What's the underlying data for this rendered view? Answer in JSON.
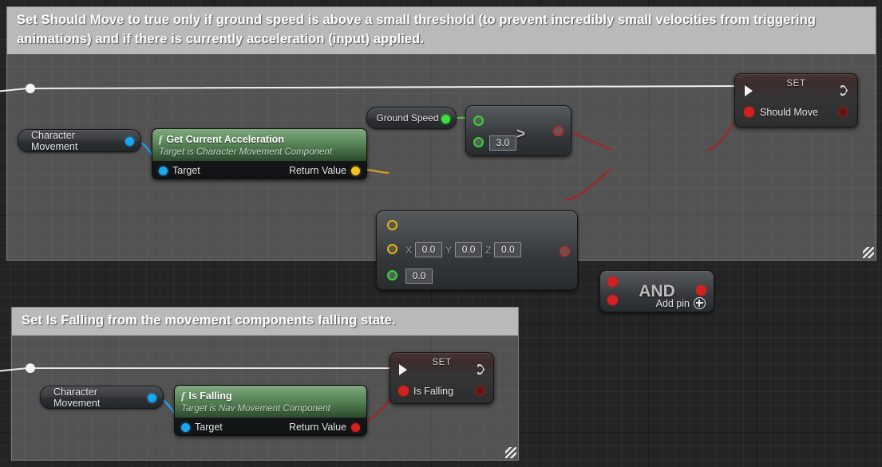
{
  "app": {
    "name": "Unreal Engine Blueprint Graph",
    "canvas_bg": "#242424"
  },
  "comments": [
    {
      "id": "comment-should-move",
      "text": "Set Should Move to true only if ground speed is above a small threshold (to prevent incredibly small velocities from triggering animations) and if there is currently acceleration (input) applied.",
      "bar_color": "#b9b9b9",
      "fill_color": "#969696"
    },
    {
      "id": "comment-is-falling",
      "text": "Set Is Falling from the movement components falling state.",
      "bar_color": "#b9b9b9",
      "fill_color": "#969696"
    }
  ],
  "nodes": {
    "character_movement_1": {
      "label": "Character Movement",
      "pin_color": "#19a6f0"
    },
    "character_movement_2": {
      "label": "Character Movement",
      "pin_color": "#19a6f0"
    },
    "get_current_acceleration": {
      "title": "Get Current Acceleration",
      "subtitle": "Target is Character Movement Component",
      "f_symbol": "f",
      "input_label": "Target",
      "output_label": "Return Value",
      "header_color": "#5d8a5d"
    },
    "ground_speed": {
      "label": "Ground Speed",
      "pin_color": "#3ce03c"
    },
    "greater_than": {
      "operator": ">",
      "input_b_value": "3.0"
    },
    "vector_length": {
      "x_label": "X",
      "y_label": "Y",
      "z_label": "Z",
      "x_value": "0.0",
      "y_value": "0.0",
      "z_value": "0.0",
      "result_value": "0.0"
    },
    "and_node": {
      "operator": "AND",
      "add_pin_label": "Add pin",
      "add_pin_icon": "plus-circle-icon"
    },
    "set_should_move": {
      "title": "SET",
      "variable_label": "Should Move",
      "exec_in_icon": "exec-arrow-icon",
      "exec_out_icon": "exec-arrow-outline-icon"
    },
    "is_falling": {
      "title": "Is Falling",
      "subtitle": "Target is Nav Movement Component",
      "f_symbol": "f",
      "input_label": "Target",
      "output_label": "Return Value",
      "header_color": "#5d8a5d"
    },
    "set_is_falling": {
      "title": "SET",
      "variable_label": "Is Falling",
      "exec_in_icon": "exec-arrow-icon",
      "exec_out_icon": "exec-arrow-outline-icon"
    }
  },
  "wires": {
    "exec_color": "#f0f0f0",
    "bool_color": "#a02626",
    "object_color": "#19a6f0",
    "float_color": "#4a8f3f",
    "vector_color": "#d9a520"
  }
}
